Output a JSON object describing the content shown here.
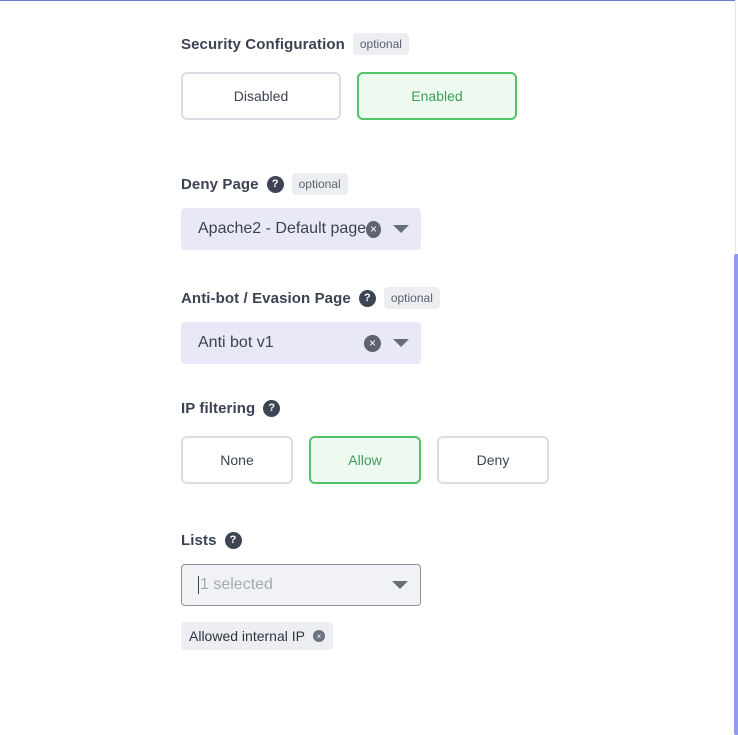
{
  "security_configuration": {
    "label": "Security Configuration",
    "badge": "optional",
    "options": [
      "Disabled",
      "Enabled"
    ],
    "selected": "Enabled"
  },
  "deny_page": {
    "label": "Deny Page",
    "help": "?",
    "badge": "optional",
    "value": "Apache2 - Default page",
    "clear_icon": "×"
  },
  "antibot_page": {
    "label": "Anti-bot / Evasion Page",
    "help": "?",
    "badge": "optional",
    "value": "Anti bot v1",
    "clear_icon": "×"
  },
  "ip_filtering": {
    "label": "IP filtering",
    "help": "?",
    "options": [
      "None",
      "Allow",
      "Deny"
    ],
    "selected": "Allow"
  },
  "lists": {
    "label": "Lists",
    "help": "?",
    "placeholder": "1 selected",
    "selected_items": [
      {
        "label": "Allowed internal IP",
        "remove_icon": "×"
      }
    ]
  },
  "colors": {
    "active_border": "#53c06a",
    "active_text": "#3f9e55",
    "select_bg": "#e8e8f8",
    "scrollbar": "#8f9af2"
  }
}
